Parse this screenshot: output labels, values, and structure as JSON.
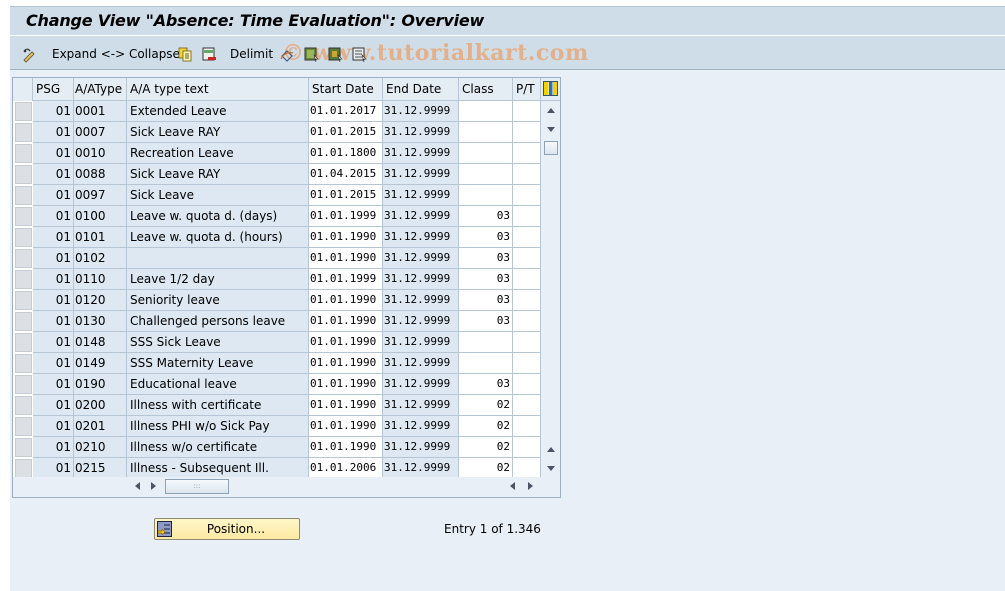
{
  "window": {
    "title": "Change View \"Absence: Time Evaluation\": Overview"
  },
  "toolbar": {
    "expand_collapse_label": "Expand <-> Collapse",
    "delimit_label": "Delimit",
    "watermark": "© www.tutorialkart.com",
    "icons": [
      "display-change-icon",
      "copy-icon",
      "delete-icon",
      "undo-change-icon",
      "select-all-icon",
      "select-block-icon",
      "deselect-all-icon"
    ]
  },
  "table": {
    "columns": [
      "PSG",
      "A/AType",
      "A/A type text",
      "Start Date",
      "End Date",
      "Class",
      "P/T"
    ],
    "rows": [
      {
        "psg": "01",
        "type": "0001",
        "text": "Extended Leave",
        "start": "01.01.2017",
        "end": "31.12.9999",
        "class": "",
        "pt": ""
      },
      {
        "psg": "01",
        "type": "0007",
        "text": "Sick Leave RAY",
        "start": "01.01.2015",
        "end": "31.12.9999",
        "class": "",
        "pt": ""
      },
      {
        "psg": "01",
        "type": "0010",
        "text": "Recreation Leave",
        "start": "01.01.1800",
        "end": "31.12.9999",
        "class": "",
        "pt": ""
      },
      {
        "psg": "01",
        "type": "0088",
        "text": "Sick Leave RAY",
        "start": "01.04.2015",
        "end": "31.12.9999",
        "class": "",
        "pt": ""
      },
      {
        "psg": "01",
        "type": "0097",
        "text": "Sick Leave",
        "start": "01.01.2015",
        "end": "31.12.9999",
        "class": "",
        "pt": ""
      },
      {
        "psg": "01",
        "type": "0100",
        "text": "Leave w. quota d. (days)",
        "start": "01.01.1999",
        "end": "31.12.9999",
        "class": "03",
        "pt": ""
      },
      {
        "psg": "01",
        "type": "0101",
        "text": "Leave w. quota d. (hours)",
        "start": "01.01.1990",
        "end": "31.12.9999",
        "class": "03",
        "pt": ""
      },
      {
        "psg": "01",
        "type": "0102",
        "text": "",
        "start": "01.01.1990",
        "end": "31.12.9999",
        "class": "03",
        "pt": ""
      },
      {
        "psg": "01",
        "type": "0110",
        "text": "Leave 1/2 day",
        "start": "01.01.1999",
        "end": "31.12.9999",
        "class": "03",
        "pt": ""
      },
      {
        "psg": "01",
        "type": "0120",
        "text": "Seniority leave",
        "start": "01.01.1990",
        "end": "31.12.9999",
        "class": "03",
        "pt": ""
      },
      {
        "psg": "01",
        "type": "0130",
        "text": "Challenged persons leave",
        "start": "01.01.1990",
        "end": "31.12.9999",
        "class": "03",
        "pt": ""
      },
      {
        "psg": "01",
        "type": "0148",
        "text": "SSS Sick Leave",
        "start": "01.01.1990",
        "end": "31.12.9999",
        "class": "",
        "pt": ""
      },
      {
        "psg": "01",
        "type": "0149",
        "text": "SSS Maternity Leave",
        "start": "01.01.1990",
        "end": "31.12.9999",
        "class": "",
        "pt": ""
      },
      {
        "psg": "01",
        "type": "0190",
        "text": "Educational leave",
        "start": "01.01.1990",
        "end": "31.12.9999",
        "class": "03",
        "pt": ""
      },
      {
        "psg": "01",
        "type": "0200",
        "text": "Illness with certificate",
        "start": "01.01.1990",
        "end": "31.12.9999",
        "class": "02",
        "pt": ""
      },
      {
        "psg": "01",
        "type": "0201",
        "text": "Illness PHI w/o Sick Pay",
        "start": "01.01.1990",
        "end": "31.12.9999",
        "class": "02",
        "pt": ""
      },
      {
        "psg": "01",
        "type": "0210",
        "text": "Illness w/o certificate",
        "start": "01.01.1990",
        "end": "31.12.9999",
        "class": "02",
        "pt": ""
      },
      {
        "psg": "01",
        "type": "0215",
        "text": "Illness - Subsequent Ill.",
        "start": "01.01.2006",
        "end": "31.12.9999",
        "class": "02",
        "pt": ""
      }
    ]
  },
  "footer": {
    "position_button_label": "Position...",
    "entry_text": "Entry 1 of 1.346"
  }
}
